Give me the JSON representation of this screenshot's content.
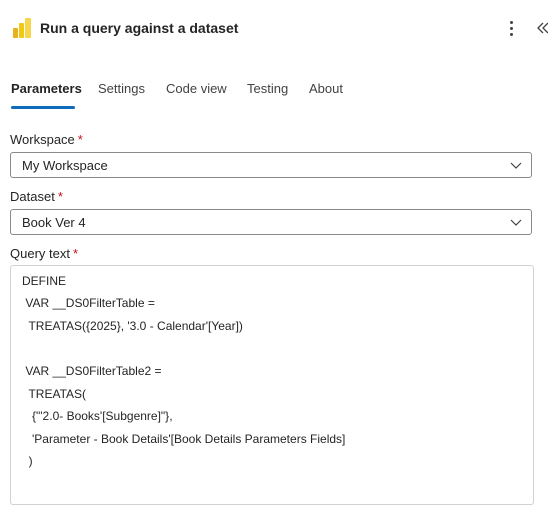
{
  "header": {
    "title": "Run a query against a dataset",
    "app_icon": "power-bi-icon",
    "more_icon": "more-vertical-icon",
    "collapse_icon": "double-chevron-left-icon"
  },
  "tabs": [
    {
      "label": "Parameters",
      "active": true
    },
    {
      "label": "Settings",
      "active": false
    },
    {
      "label": "Code view",
      "active": false
    },
    {
      "label": "Testing",
      "active": false
    },
    {
      "label": "About",
      "active": false
    }
  ],
  "form": {
    "required_marker": "*",
    "workspace": {
      "label": "Workspace",
      "value": "My Workspace"
    },
    "dataset": {
      "label": "Dataset",
      "value": "Book Ver 4"
    },
    "query": {
      "label": "Query text",
      "lines": [
        "DEFINE",
        " VAR __DS0FilterTable =",
        "  TREATAS({2025}, '3.0 - Calendar'[Year])",
        "",
        " VAR __DS0FilterTable2 =",
        "  TREATAS(",
        "   {\"'2.0- Books'[Subgenre]\"},",
        "   'Parameter - Book Details'[Book Details Parameters Fields]",
        "  )"
      ]
    }
  },
  "colors": {
    "accent": "#0f6cbd",
    "required": "#c50f1f",
    "text": "#242424"
  }
}
